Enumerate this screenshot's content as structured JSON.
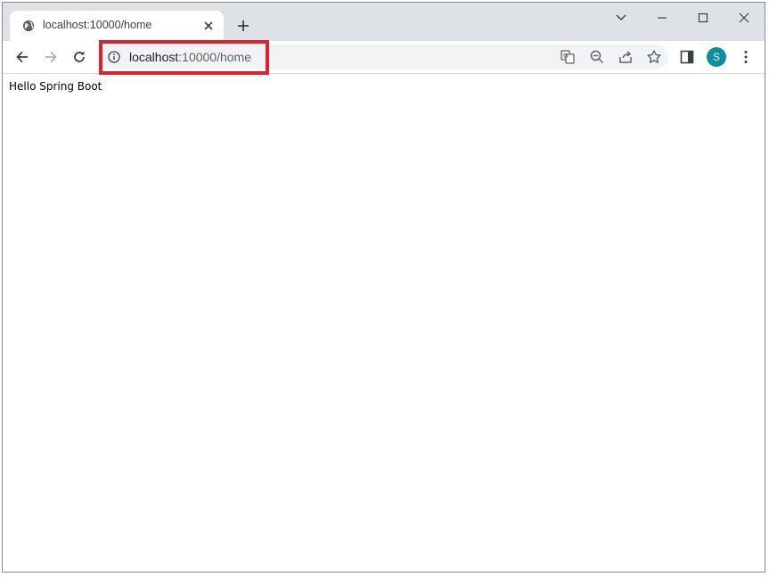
{
  "tab": {
    "title": "localhost:10000/home"
  },
  "address_bar": {
    "host": "localhost",
    "path": ":10000/home"
  },
  "profile": {
    "initial": "S",
    "color": "#0b8e9e"
  },
  "page": {
    "body_text": "Hello Spring Boot"
  },
  "icons": {
    "favicon": "globe-icon",
    "info": "info-icon",
    "translate": "translate-icon",
    "zoom": "zoom-out-icon",
    "share": "share-icon",
    "bookmark": "star-icon",
    "side_panel": "side-panel-icon",
    "menu": "kebab-menu-icon"
  },
  "annotation": {
    "highlight_color": "#e0202b"
  }
}
